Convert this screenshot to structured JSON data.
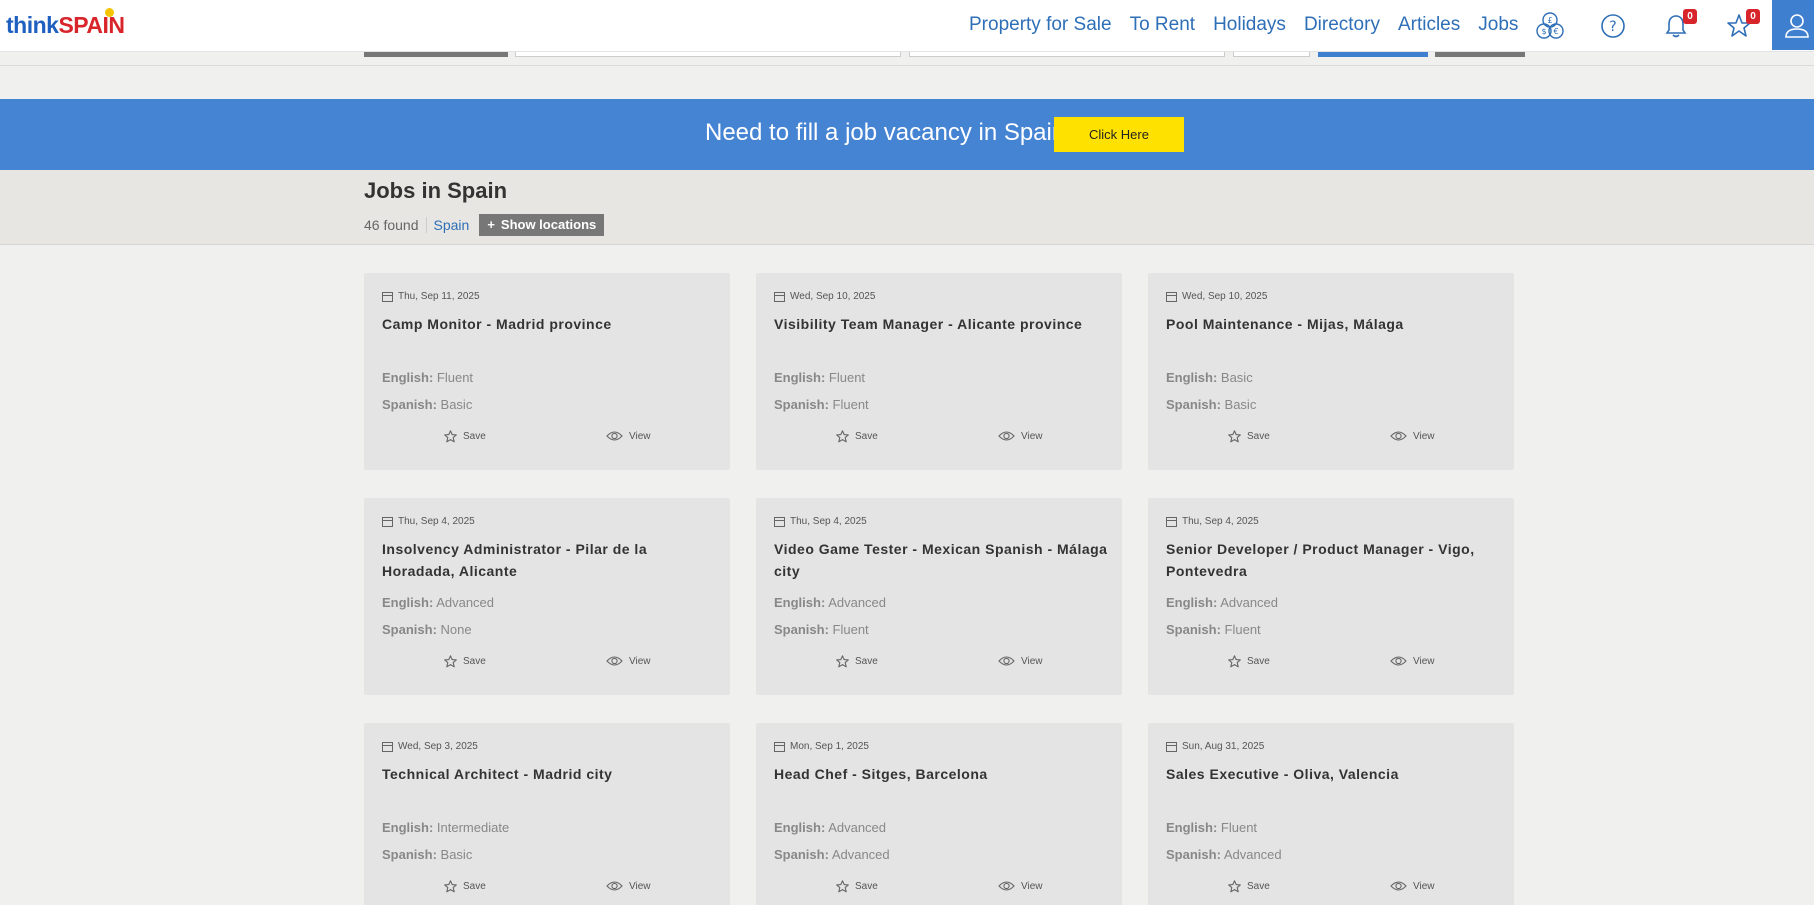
{
  "header": {
    "logo_think": "think",
    "logo_spain": "SPAIN",
    "nav": [
      "Property for Sale",
      "To Rent",
      "Holidays",
      "Directory",
      "Articles",
      "Jobs"
    ],
    "notifications_count": "0",
    "favourites_count": "0"
  },
  "banner": {
    "text": "Need to fill a job vacancy in Spain?",
    "button": "Click Here"
  },
  "results": {
    "title": "Jobs in Spain",
    "found": "46 found",
    "region": "Spain",
    "show_locations": "Show locations"
  },
  "labels": {
    "english": "English:",
    "spanish": "Spanish:",
    "save": "Save",
    "view": "View"
  },
  "jobs": [
    {
      "date": "Thu, Sep 11, 2025",
      "title": "Camp Monitor - Madrid province",
      "english": "Fluent",
      "spanish": "Basic"
    },
    {
      "date": "Wed, Sep 10, 2025",
      "title": "Visibility Team Manager - Alicante province",
      "english": "Fluent",
      "spanish": "Fluent"
    },
    {
      "date": "Wed, Sep 10, 2025",
      "title": "Pool Maintenance - Mijas, Málaga",
      "english": "Basic",
      "spanish": "Basic"
    },
    {
      "date": "Thu, Sep 4, 2025",
      "title": "Insolvency Administrator - Pilar de la Horadada, Alicante",
      "english": "Advanced",
      "spanish": "None"
    },
    {
      "date": "Thu, Sep 4, 2025",
      "title": "Video Game Tester - Mexican Spanish - Málaga city",
      "english": "Advanced",
      "spanish": "Fluent"
    },
    {
      "date": "Thu, Sep 4, 2025",
      "title": "Senior Developer / Product Manager - Vigo, Pontevedra",
      "english": "Advanced",
      "spanish": "Fluent"
    },
    {
      "date": "Wed, Sep 3, 2025",
      "title": "Technical Architect - Madrid city",
      "english": "Intermediate",
      "spanish": "Basic"
    },
    {
      "date": "Mon, Sep 1, 2025",
      "title": "Head Chef - Sitges, Barcelona",
      "english": "Advanced",
      "spanish": "Advanced"
    },
    {
      "date": "Sun, Aug 31, 2025",
      "title": "Sales Executive - Oliva, Valencia",
      "english": "Fluent",
      "spanish": "Advanced"
    }
  ],
  "colors": {
    "brand_blue": "#2e6fb7",
    "banner_blue": "#4583d3",
    "cta_yellow": "#ffe100",
    "badge_red": "#d8252b"
  }
}
